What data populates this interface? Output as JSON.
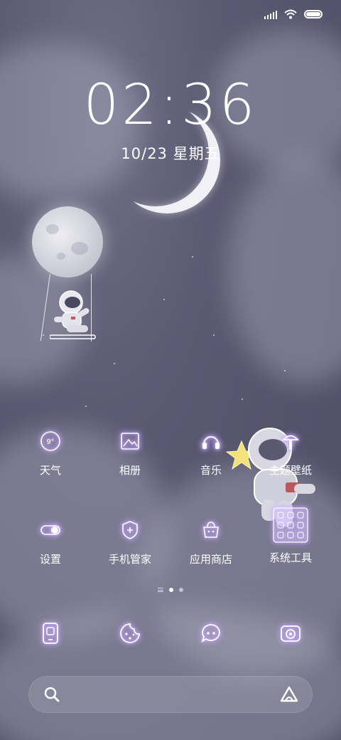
{
  "status_bar": {
    "battery_level": 1.0
  },
  "clock": {
    "time": "02:36",
    "date": "10/23 星期五"
  },
  "apps": [
    {
      "label": "天气",
      "icon": "weather-icon",
      "icon_text": "9°"
    },
    {
      "label": "相册",
      "icon": "gallery-icon"
    },
    {
      "label": "音乐",
      "icon": "music-icon"
    },
    {
      "label": "主题壁纸",
      "icon": "themes-icon"
    },
    {
      "label": "设置",
      "icon": "settings-icon"
    },
    {
      "label": "手机管家",
      "icon": "security-icon"
    },
    {
      "label": "应用商店",
      "icon": "app-store-icon"
    },
    {
      "label": "系统工具",
      "icon": "system-tools-icon"
    }
  ],
  "page_indicator": {
    "pages": 2,
    "active": 0
  },
  "dock": [
    {
      "icon": "phone-icon"
    },
    {
      "icon": "browser-icon"
    },
    {
      "icon": "messages-icon"
    },
    {
      "icon": "camera-icon"
    }
  ],
  "colors": {
    "accent_glow": "#c9a7ff",
    "icon_stroke": "#ffffff",
    "star": "#f3e27a"
  }
}
